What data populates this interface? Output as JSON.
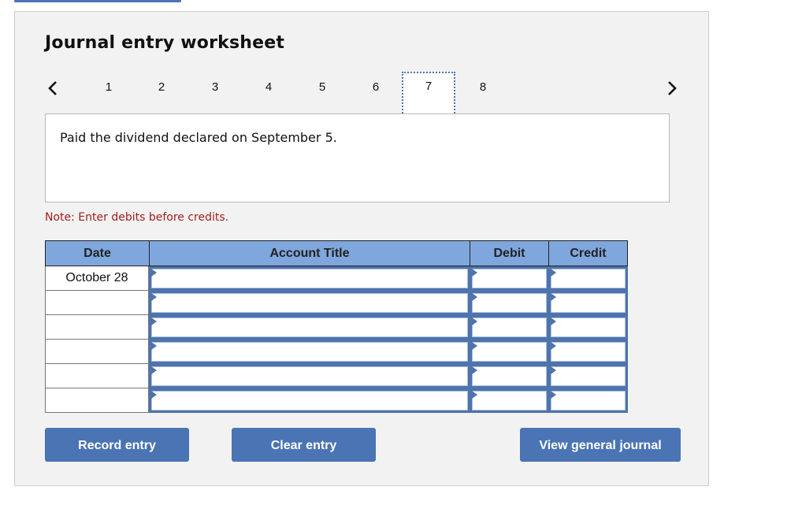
{
  "header": {
    "title": "Journal entry worksheet"
  },
  "nav": {
    "prev_icon": "chevron-left-icon",
    "next_icon": "chevron-right-icon",
    "steps": [
      "1",
      "2",
      "3",
      "4",
      "5",
      "6",
      "7",
      "8"
    ],
    "active_step": "7"
  },
  "description": "Paid the dividend declared on September 5.",
  "note": "Note: Enter debits before credits.",
  "table": {
    "headers": {
      "date": "Date",
      "account": "Account Title",
      "debit": "Debit",
      "credit": "Credit"
    },
    "rows": [
      {
        "date": "October 28",
        "account": "",
        "debit": "",
        "credit": ""
      },
      {
        "date": "",
        "account": "",
        "debit": "",
        "credit": ""
      },
      {
        "date": "",
        "account": "",
        "debit": "",
        "credit": ""
      },
      {
        "date": "",
        "account": "",
        "debit": "",
        "credit": ""
      },
      {
        "date": "",
        "account": "",
        "debit": "",
        "credit": ""
      },
      {
        "date": "",
        "account": "",
        "debit": "",
        "credit": ""
      }
    ]
  },
  "buttons": {
    "record": "Record entry",
    "clear": "Clear entry",
    "view_journal": "View general journal"
  },
  "colors": {
    "accent": "#4a74b4",
    "header_bg": "#7fa7de",
    "note": "#a61c1c",
    "panel_bg": "#f2f2f2"
  }
}
